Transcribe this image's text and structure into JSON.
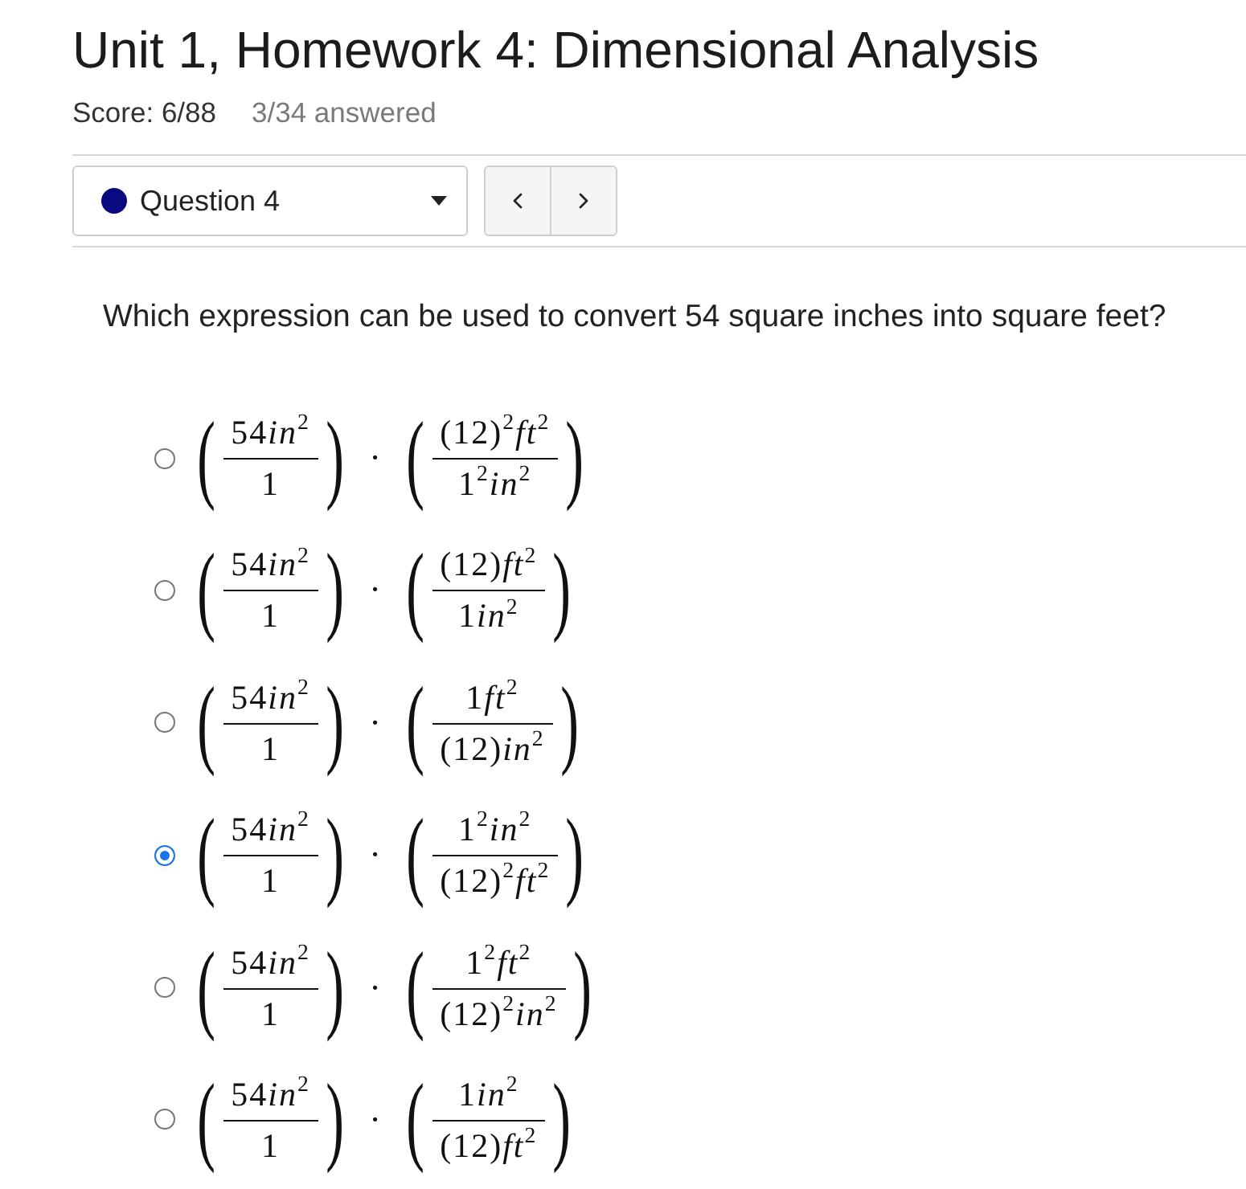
{
  "assignment": {
    "title": "Unit 1, Homework 4: Dimensional Analysis",
    "score": "Score: 6/88",
    "progress": "3/34 answered"
  },
  "question_selector": {
    "label": "Question 4",
    "color": "#0a0a80"
  },
  "question": {
    "prompt": "Which expression can be used to convert 54 square inches into square feet?",
    "options": [
      {
        "selected": false,
        "operator": "·",
        "factors": [
          {
            "open": "(",
            "numerator": [
              "54",
              "*in*$^{2}$"
            ],
            "denominator": [
              "1"
            ],
            "close": ")"
          },
          {
            "open": "(",
            "numerator": [
              "(12)$^{2}$",
              "*ft*$^{2}$"
            ],
            "denominator": [
              "1$^{2}$",
              "*in*$^{2}$"
            ],
            "close": ")"
          }
        ]
      },
      {
        "selected": false,
        "operator": "·",
        "factors": [
          {
            "open": "(",
            "numerator": [
              "54",
              "*in*$^{2}$"
            ],
            "denominator": [
              "1"
            ],
            "close": ")"
          },
          {
            "open": "(",
            "numerator": [
              "(12)",
              "*ft*$^{2}$"
            ],
            "denominator": [
              "1",
              "*in*$^{2}$"
            ],
            "close": ")"
          }
        ]
      },
      {
        "selected": false,
        "operator": "·",
        "factors": [
          {
            "open": "(",
            "numerator": [
              "54",
              "*in*$^{2}$"
            ],
            "denominator": [
              "1"
            ],
            "close": ")"
          },
          {
            "open": "(",
            "numerator": [
              "1",
              "*ft*$^{2}$"
            ],
            "denominator": [
              "(12)",
              "*in*$^{2}$"
            ],
            "close": ")"
          }
        ]
      },
      {
        "selected": true,
        "operator": "·",
        "factors": [
          {
            "open": "(",
            "numerator": [
              "54",
              "*in*$^{2}$"
            ],
            "denominator": [
              "1"
            ],
            "close": ")"
          },
          {
            "open": "(",
            "numerator": [
              "1$^{2}$",
              "*in*$^{2}$"
            ],
            "denominator": [
              "(12)$^{2}$",
              "*ft*$^{2}$"
            ],
            "close": ")"
          }
        ]
      },
      {
        "selected": false,
        "operator": "·",
        "factors": [
          {
            "open": "(",
            "numerator": [
              "54",
              "*in*$^{2}$"
            ],
            "denominator": [
              "1"
            ],
            "close": ")"
          },
          {
            "open": "(",
            "numerator": [
              "1$^{2}$",
              "*ft*$^{2}$"
            ],
            "denominator": [
              "(12)$^{2}$",
              "*in*$^{2}$"
            ],
            "close": ")"
          }
        ]
      },
      {
        "selected": false,
        "operator": "·",
        "factors": [
          {
            "open": "(",
            "numerator": [
              "54",
              "*in*$^{2}$"
            ],
            "denominator": [
              "1"
            ],
            "close": ")"
          },
          {
            "open": "(",
            "numerator": [
              "1",
              "*in*$^{2}$"
            ],
            "denominator": [
              "(12)",
              "*ft*$^{2}$"
            ],
            "close": ")"
          }
        ]
      }
    ]
  }
}
